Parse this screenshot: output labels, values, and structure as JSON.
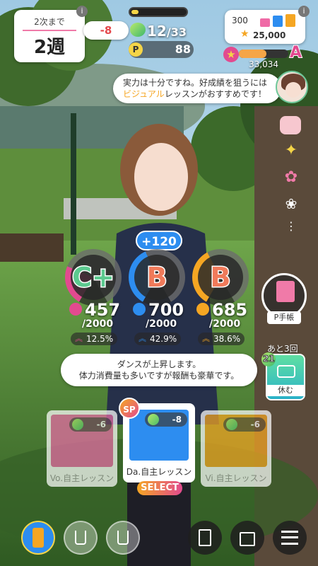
{
  "week": {
    "label": "2次まで",
    "value": "2週"
  },
  "hp": {
    "delta": "-8",
    "current": "12",
    "max": "/33"
  },
  "p_points": "88",
  "support": {
    "count": "300",
    "points": "25,000"
  },
  "score": {
    "value": "33,034",
    "rank": "A",
    "progress": 0.55
  },
  "advice": {
    "line1": "実力は十分ですね。好成績を狙うには",
    "highlight": "ビジュアル",
    "line2": "レッスンがおすすめです！"
  },
  "stat_gain": "+120",
  "stats": [
    {
      "rank": "C+",
      "value": "457",
      "max": "/2000",
      "pct": "12.5%",
      "color": "#e24a8f",
      "fill": 0.23
    },
    {
      "rank": "B",
      "value": "700",
      "max": "/2000",
      "pct": "42.9%",
      "color": "#2d8df0",
      "fill": 0.35
    },
    {
      "rank": "B",
      "value": "685",
      "max": "/2000",
      "pct": "38.6%",
      "color": "#f5a623",
      "fill": 0.34
    }
  ],
  "p_notebook": "P手帳",
  "rest": {
    "remaining": "あと3回",
    "hp": "21",
    "label": "休む"
  },
  "desc": {
    "line1": "ダンスが上昇します。",
    "line2": "体力消費量も多いですが報酬も豪華です。"
  },
  "sp_badge": "SP",
  "lessons": [
    {
      "label": "Vo.自主レッスン",
      "cost": "-6",
      "color": "#e96da7"
    },
    {
      "label": "Da.自主レッスン",
      "cost": "-8",
      "color": "#2d8df0"
    },
    {
      "label": "Vi.自主レッスン",
      "cost": "-6",
      "color": "#f5a623"
    }
  ],
  "select_label": "SELECT",
  "info_glyph": "i",
  "more_glyph": "⋮",
  "icons": [
    "drink-can-icon",
    "empty-cup-icon",
    "document-icon",
    "shop-icon",
    "menu-icon",
    "pouch-icon",
    "sparkle-charm-icon",
    "flower-charm-icon",
    "bouquet-charm-icon",
    "notebook-icon",
    "sofa-icon",
    "microphone-icon",
    "dance-icon",
    "visual-icon"
  ]
}
